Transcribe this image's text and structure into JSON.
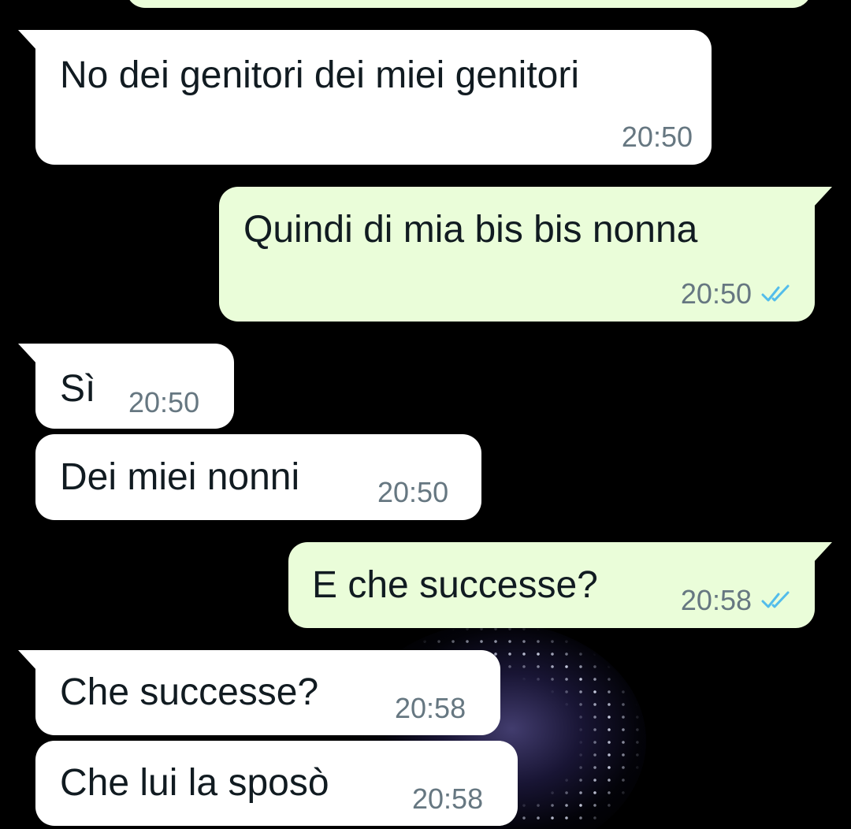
{
  "messages": [
    {
      "direction": "out",
      "text": "",
      "time": "",
      "read_icon": "double-check-icon"
    },
    {
      "direction": "in",
      "text": "No dei genitori dei miei genitori",
      "time": "20:50"
    },
    {
      "direction": "out",
      "text": "Quindi di mia bis bis nonna",
      "time": "20:50",
      "read_icon": "double-check-icon"
    },
    {
      "direction": "in",
      "text": "Sì",
      "time": "20:50"
    },
    {
      "direction": "in",
      "text": "Dei miei nonni",
      "time": "20:50"
    },
    {
      "direction": "out",
      "text": "E che successe?",
      "time": "20:58",
      "read_icon": "double-check-icon"
    },
    {
      "direction": "in",
      "text": "Che successe?",
      "time": "20:58"
    },
    {
      "direction": "in",
      "text": "Che lui la sposò",
      "time": "20:58"
    }
  ],
  "colors": {
    "background": "#000000",
    "incoming_bubble": "#ffffff",
    "outgoing_bubble": "#eafdd9",
    "timestamp": "#667781",
    "read_ticks": "#53bdeb"
  },
  "wallpaper": {
    "icon": "jellyfish-wallpaper"
  }
}
